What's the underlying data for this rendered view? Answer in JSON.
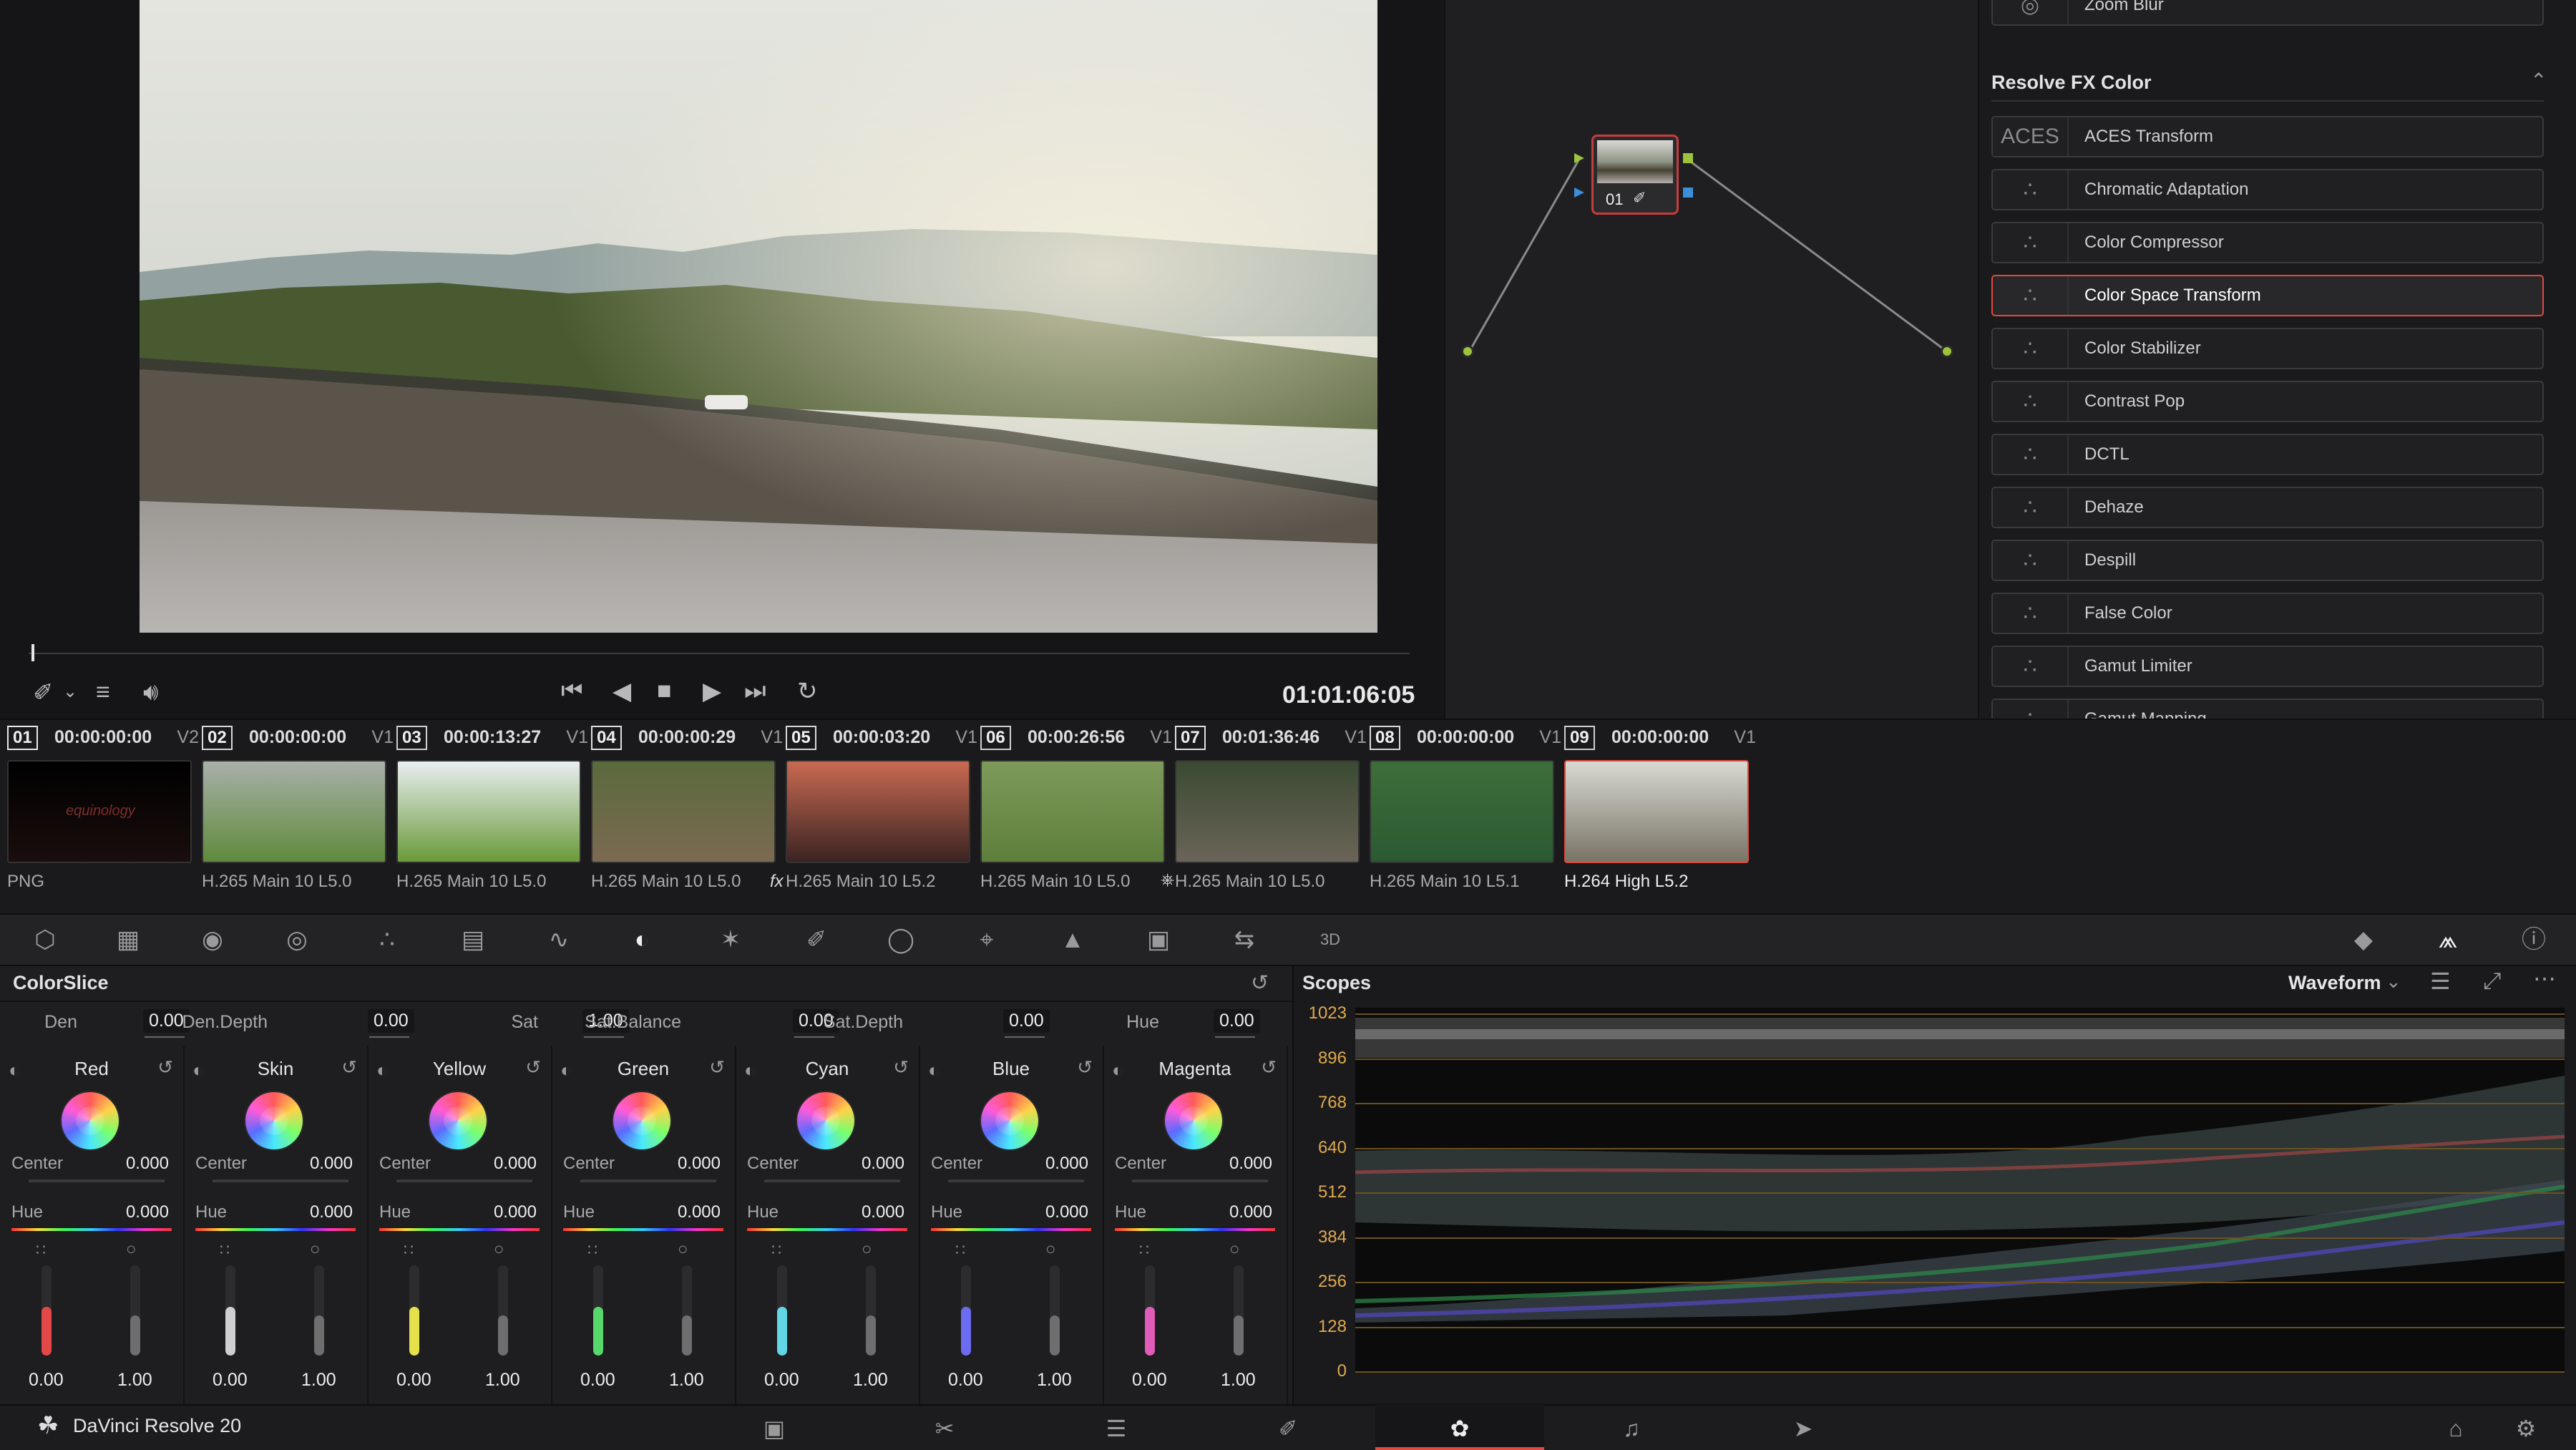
{
  "app": {
    "name": "DaVinci Resolve 20"
  },
  "viewer": {
    "timecode": "01:01:06:05"
  },
  "effects": {
    "top_item": "Zoom Blur",
    "section_title": "Resolve FX Color",
    "items": [
      {
        "label": "ACES Transform",
        "icon": "ACES"
      },
      {
        "label": "Chromatic Adaptation",
        "icon": "chromatic-adaptation-icon"
      },
      {
        "label": "Color Compressor",
        "icon": "color-compressor-icon"
      },
      {
        "label": "Color Space Transform",
        "icon": "color-space-transform-icon",
        "selected": true
      },
      {
        "label": "Color Stabilizer",
        "icon": "color-stabilizer-icon"
      },
      {
        "label": "Contrast Pop",
        "icon": "contrast-pop-icon"
      },
      {
        "label": "DCTL",
        "icon": "dctl-icon"
      },
      {
        "label": "Dehaze",
        "icon": "dehaze-icon"
      },
      {
        "label": "Despill",
        "icon": "despill-icon"
      },
      {
        "label": "False Color",
        "icon": "false-color-icon"
      },
      {
        "label": "Gamut Limiter",
        "icon": "gamut-limiter-icon"
      },
      {
        "label": "Gamut Mapping",
        "icon": "gamut-mapping-icon"
      }
    ]
  },
  "node": {
    "label": "01"
  },
  "clips": [
    {
      "num": "01",
      "tc": "00:00:00:00",
      "track": "V2",
      "codec": "PNG",
      "colors": [
        "#000000",
        "#1a0d0d"
      ],
      "logo": "equinology"
    },
    {
      "num": "02",
      "tc": "00:00:00:00",
      "track": "V1",
      "codec": "H.265 Main 10 L5.0",
      "colors": [
        "#a9b0a9",
        "#5f8a3c"
      ]
    },
    {
      "num": "03",
      "tc": "00:00:13:27",
      "track": "V1",
      "codec": "H.265 Main 10 L5.0",
      "colors": [
        "#e9eef0",
        "#6a9a3a"
      ]
    },
    {
      "num": "04",
      "tc": "00:00:00:29",
      "track": "V1",
      "codec": "H.265 Main 10 L5.0",
      "colors": [
        "#5a6a3c",
        "#7c6a52"
      ]
    },
    {
      "num": "05",
      "tc": "00:00:03:20",
      "track": "V1",
      "codec": "H.265 Main 10 L5.2",
      "colors": [
        "#c96a52",
        "#3b2422"
      ],
      "fx": true
    },
    {
      "num": "06",
      "tc": "00:00:26:56",
      "track": "V1",
      "codec": "H.265 Main 10 L5.0",
      "colors": [
        "#7d9a5a",
        "#5e7f3c"
      ]
    },
    {
      "num": "07",
      "tc": "00:01:36:46",
      "track": "V1",
      "codec": "H.265 Main 10 L5.0",
      "colors": [
        "#3a4a32",
        "#6b6458"
      ],
      "link": true
    },
    {
      "num": "08",
      "tc": "00:00:00:00",
      "track": "V1",
      "codec": "H.265 Main 10 L5.1",
      "colors": [
        "#3d6e3a",
        "#2b5a32"
      ]
    },
    {
      "num": "09",
      "tc": "00:00:00:00",
      "track": "V1",
      "codec": "H.264 High L5.2",
      "colors": [
        "#d8d9d2",
        "#7a7466"
      ],
      "selected": true
    }
  ],
  "colorslice": {
    "title": "ColorSlice",
    "params": [
      {
        "label": "Den",
        "value": "0.00"
      },
      {
        "label": "Den.Depth",
        "value": "0.00"
      },
      {
        "label": "Sat",
        "value": "1.00"
      },
      {
        "label": "Sat.Balance",
        "value": "0.00"
      },
      {
        "label": "Sat.Depth",
        "value": "0.00"
      },
      {
        "label": "Hue",
        "value": "0.00"
      }
    ],
    "center_label": "Center",
    "hue_label": "Hue",
    "vectors": [
      {
        "name": "Red",
        "center": "0.000",
        "hue": "0.000",
        "low": "0.00",
        "high": "1.00",
        "color": "#e24848"
      },
      {
        "name": "Skin",
        "center": "0.000",
        "hue": "0.000",
        "low": "0.00",
        "high": "1.00",
        "color": "#cfcfcf"
      },
      {
        "name": "Yellow",
        "center": "0.000",
        "hue": "0.000",
        "low": "0.00",
        "high": "1.00",
        "color": "#e6e04a"
      },
      {
        "name": "Green",
        "center": "0.000",
        "hue": "0.000",
        "low": "0.00",
        "high": "1.00",
        "color": "#58d86a"
      },
      {
        "name": "Cyan",
        "center": "0.000",
        "hue": "0.000",
        "low": "0.00",
        "high": "1.00",
        "color": "#62d6e6"
      },
      {
        "name": "Blue",
        "center": "0.000",
        "hue": "0.000",
        "low": "0.00",
        "high": "1.00",
        "color": "#6c6cf0"
      },
      {
        "name": "Magenta",
        "center": "0.000",
        "hue": "0.000",
        "low": "0.00",
        "high": "1.00",
        "color": "#e05cb8"
      }
    ]
  },
  "scopes": {
    "title": "Scopes",
    "mode": "Waveform",
    "levels": [
      "1023",
      "896",
      "768",
      "640",
      "512",
      "384",
      "256",
      "128",
      "0"
    ]
  }
}
